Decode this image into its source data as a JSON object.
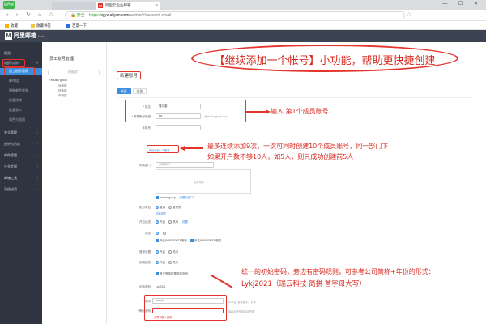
{
  "browser": {
    "logo_label": "绿色浏览器",
    "tabs": [
      {
        "label": "阿里云企业邮箱",
        "active": true
      },
      {
        "label": "",
        "active": false
      }
    ],
    "window_controls": "— ☐ ✕",
    "secure_label": "安全",
    "url_proto": "https://",
    "url_host": "qiye.aliyun.com",
    "url_path": "/admin/#/account-email",
    "bookmarks": [
      "收藏",
      "收藏书签",
      "百度一下"
    ]
  },
  "app": {
    "logo_mark": "M",
    "logo_text": "阿里邮箱",
    "logo_sub": "Link"
  },
  "sidebar": {
    "items": [
      {
        "label": "概览",
        "type": "top"
      },
      {
        "label": "组织与用户",
        "type": "top",
        "highlight": true
      },
      {
        "label": "员工账号管理",
        "type": "sub",
        "active": true
      },
      {
        "label": "邮件组",
        "type": "sub"
      },
      {
        "label": "限制邮件收发",
        "type": "sub"
      },
      {
        "label": "批量修改",
        "type": "sub"
      },
      {
        "label": "批量导入",
        "type": "sub"
      },
      {
        "label": "角色与权限",
        "type": "sub"
      },
      {
        "label": "安全管理",
        "type": "top"
      },
      {
        "label": "统计与日志",
        "type": "top"
      },
      {
        "label": "邮件管理",
        "type": "top"
      },
      {
        "label": "企业定制",
        "type": "top"
      },
      {
        "label": "邮箱工具",
        "type": "top"
      },
      {
        "label": "高级应用",
        "type": "top"
      }
    ]
  },
  "tree": {
    "title": "员工帐号管理",
    "search_placeholder": "搜索部门",
    "root": "▾ ebusin group",
    "children": [
      "运营部",
      "技术部",
      "市场部"
    ]
  },
  "main": {
    "heading": "新建账号",
    "tabs": [
      "新建",
      "批量"
    ],
    "fields": {
      "name_label": "* 姓名",
      "name_value": "雪儿某",
      "account_label": "* 邮箱账号前缀",
      "account_value": "lxy",
      "account_suffix": "@ebusin-group.com",
      "phone_label": "手机号",
      "add_more_link": "继续添加一个账号",
      "dept_label": "所属部门",
      "dept_placeholder": "选择部门",
      "dept_box_hint": "点击添加",
      "dept_chip": "ebusin group",
      "dept_link": "设置为部门",
      "role_label": "账号角色",
      "role_options": [
        "普通",
        "管理员"
      ],
      "role_link": "设置权限",
      "enable_label": "开启状态",
      "enable_options": [
        "开启",
        "禁用"
      ],
      "enable_link": "设置",
      "protocol_label": "协议",
      "protocol_options": [
        "开启POP3/SMTP服务",
        "开启IMAP/SMTP服务"
      ],
      "login_label": "登录设置",
      "login_options": [
        "开启",
        "关闭"
      ],
      "notify_label": "到期通知",
      "notify_options": [
        "开启",
        "关闭"
      ],
      "change_pwd_option": "首次登录时需修改密码",
      "password_label": "初始密码",
      "password_hint": "Lykj2021",
      "password_field_label": "* 密码",
      "password_value": "••••••••",
      "password_rule": "6-32位, 包含数字、字母",
      "confirm_label": "* 确认密码",
      "confirm_error": "请再次输入密码",
      "bottom_note": "保存后账号将自动开通"
    }
  },
  "annotations": {
    "headline": "【继续添加一个帐号】小功能，帮助更快捷创建",
    "note1": "输入 第1个成员账号",
    "note2_line1": "最多连续添加9次，一次可同时创建10个成员账号，同一部门下",
    "note2_line2": "如果开户数不够10人，如5人，则只成功创建前5人",
    "note3_line1": "统一的初始密码，旁边有密码规则，可参考公司简称+年份的形式：",
    "note3_line2": "Lykj2021（瑞云科技 简拼 首字母大写）",
    "color": "#d8261d"
  }
}
